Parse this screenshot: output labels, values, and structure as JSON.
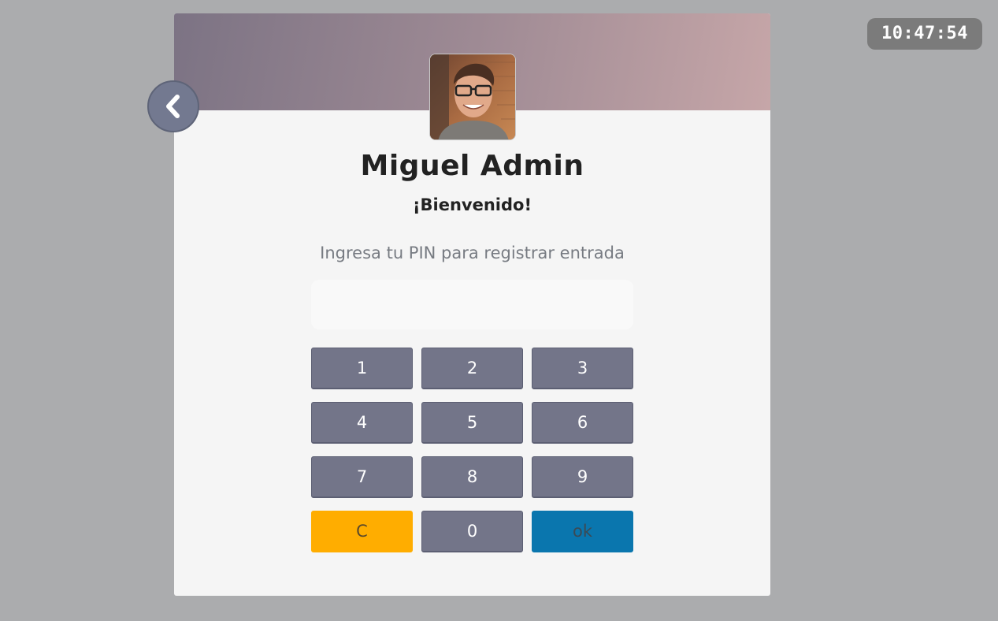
{
  "clock": {
    "time": "10:47:54"
  },
  "user": {
    "name": "Miguel Admin",
    "greeting": "¡Bienvenido!"
  },
  "pin": {
    "instruction": "Ingresa tu PIN para registrar entrada",
    "value": ""
  },
  "keypad": {
    "keys": [
      "1",
      "2",
      "3",
      "4",
      "5",
      "6",
      "7",
      "8",
      "9",
      "C",
      "0",
      "ok"
    ]
  },
  "colors": {
    "background": "#abacae",
    "card": "#f5f5f5",
    "key": "#737589",
    "clear": "#ffad00",
    "ok": "#0a76ae"
  },
  "icons": {
    "back": "chevron-left-icon"
  }
}
